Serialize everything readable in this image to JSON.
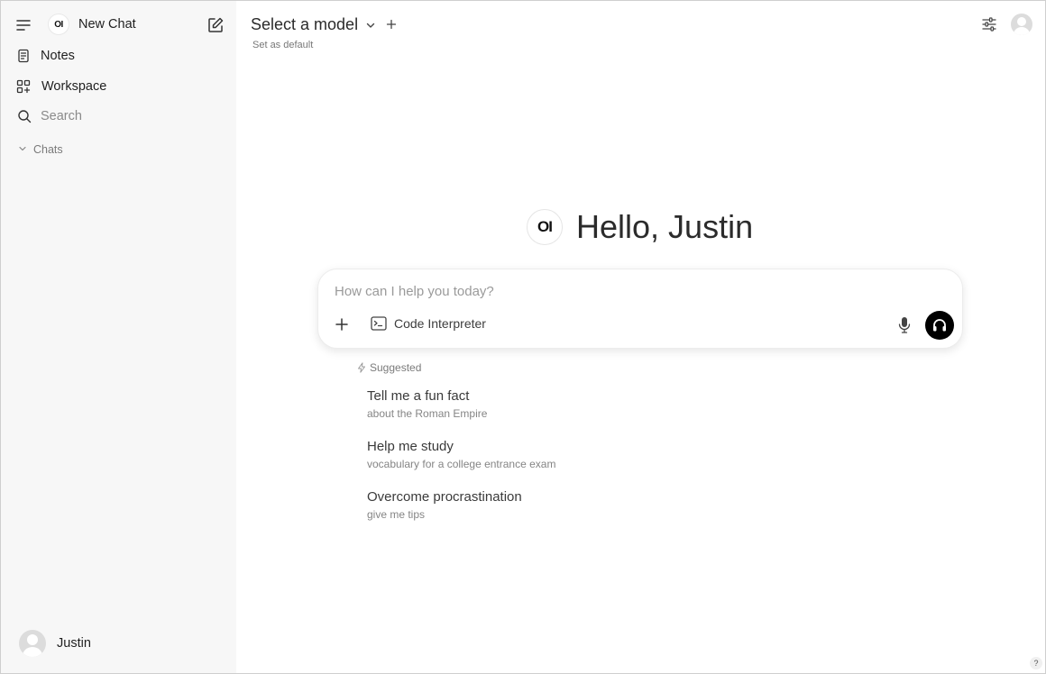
{
  "sidebar": {
    "app_name": "New Chat",
    "logo_text": "OI",
    "items": [
      {
        "label": "Notes"
      },
      {
        "label": "Workspace"
      }
    ],
    "search_placeholder": "Search",
    "chats_label": "Chats",
    "user_name": "Justin"
  },
  "header": {
    "model_select_label": "Select a model",
    "set_default_label": "Set as default"
  },
  "hero": {
    "logo_text": "OI",
    "greeting": "Hello, Justin"
  },
  "composer": {
    "placeholder": "How can I help you today?",
    "code_interpreter_label": "Code Interpreter"
  },
  "suggestions": {
    "label": "Suggested",
    "items": [
      {
        "title": "Tell me a fun fact",
        "subtitle": "about the Roman Empire"
      },
      {
        "title": "Help me study",
        "subtitle": "vocabulary for a college entrance exam"
      },
      {
        "title": "Overcome procrastination",
        "subtitle": "give me tips"
      }
    ]
  },
  "footer": {
    "help_label": "?"
  },
  "colors": {
    "sidebar_bg": "#f7f7f7",
    "voice_button_bg": "#000000"
  }
}
